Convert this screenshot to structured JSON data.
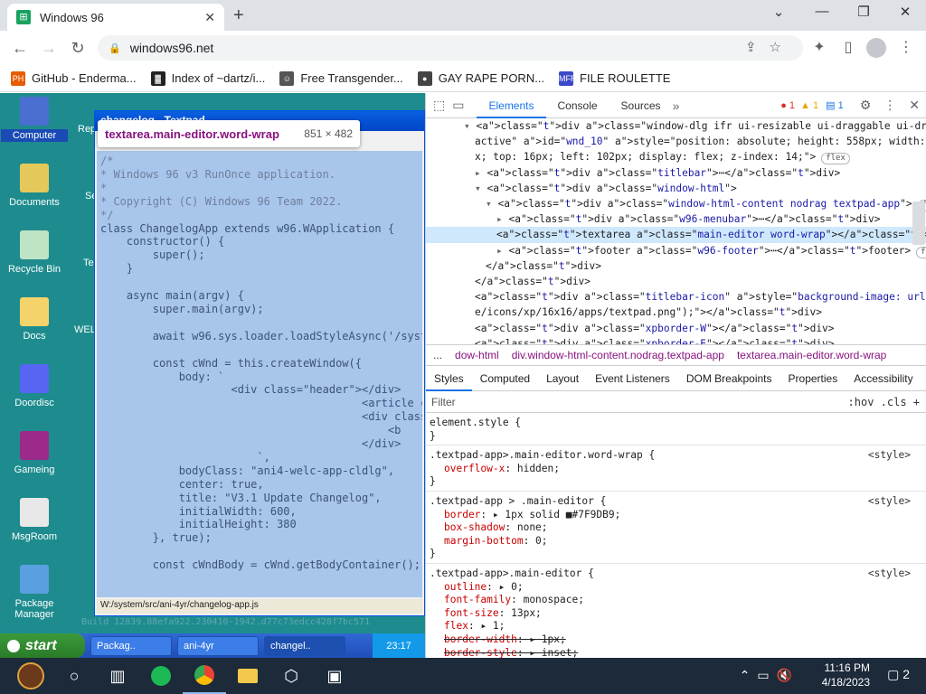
{
  "browser": {
    "tab_title": "Windows 96",
    "url": "windows96.net",
    "bookmarks": [
      {
        "label": "GitHub - Enderma...",
        "icon": "ph-icon",
        "color": "#e65c00",
        "glyph": "PH"
      },
      {
        "label": "Index of ~dartz/i...",
        "icon": "app-icon",
        "color": "#222222",
        "glyph": "▓"
      },
      {
        "label": "Free Transgender...",
        "icon": "cat-icon",
        "color": "#555555",
        "glyph": "☺"
      },
      {
        "label": "GAY RAPE PORN...",
        "icon": "globe-icon",
        "color": "#444444",
        "glyph": "●"
      },
      {
        "label": "FILE ROULETTE",
        "icon": "mfr-icon",
        "color": "#3b48c8",
        "glyph": "MFR"
      }
    ]
  },
  "desktop": {
    "icons": [
      {
        "label": "Computer",
        "color": "#4a6fd0",
        "name": "computer-icon"
      },
      {
        "label": "Documents",
        "color": "#e5c85a",
        "name": "documents-icon"
      },
      {
        "label": "Recycle Bin",
        "color": "#bfe3c5",
        "name": "recycle-bin-icon"
      },
      {
        "label": "Docs",
        "color": "#f5d36b",
        "name": "docs-folder-icon"
      },
      {
        "label": "Doordisc",
        "color": "#5865f2",
        "name": "doordisc-icon"
      },
      {
        "label": "Gameing",
        "color": "#9b2a8a",
        "name": "gameing-icon"
      },
      {
        "label": "MsgRoom",
        "color": "#e8e8e8",
        "name": "msgroom-icon"
      },
      {
        "label": "Package Manager",
        "color": "#5a9fe0",
        "name": "package-manager-icon"
      }
    ],
    "partial_labels": [
      "Rep",
      "Se",
      "Te",
      "WEL"
    ],
    "window": {
      "title": "changelog - Textpad",
      "menu": "Edit    Help",
      "footer_path": "W:/system/src/ani-4yr/changelog-app.js",
      "code_comment": "/*\n* Windows 96 v3 RunOnce application.\n*\n* Copyright (C) Windows 96 Team 2022.\n*/",
      "code_body": "\nclass ChangelogApp extends w96.WApplication {\n    constructor() {\n        super();\n    }\n\n    async main(argv) {\n        super.main(argv);\n\n        await w96.sys.loader.loadStyleAsync('/syste\n\n        const cWnd = this.createWindow({\n            body: `\n                    <div class=\"header\"></div>\n                                        <article c\n                                        <div class\n                                            <b\n                                        </div>\n                        `,\n            bodyClass: \"ani4-welc-app-cldlg\",\n            center: true,\n            title: \"V3.1 Update Changelog\",\n            initialWidth: 600,\n            initialHeight: 380\n        }, true);\n\n        const cWndBody = cWnd.getBodyContainer();"
    },
    "tooltip": {
      "tag": "textarea.main-editor.word-wrap",
      "size": "851 × 482"
    },
    "build_text": "Build 12839.88efa922.230410-1942.d77c73edcc428f7bc571",
    "taskbar": {
      "start": "start",
      "tasks": [
        "Packag..",
        "ani-4yr",
        "changel.."
      ],
      "clock": "23:17"
    }
  },
  "devtools": {
    "tabs": [
      "Elements",
      "Console",
      "Sources"
    ],
    "active_tab": "Elements",
    "error_count": "1",
    "warning_count": "1",
    "info_count": "1",
    "dom_lines": [
      {
        "indent": 3,
        "tri": "▾",
        "html": "<div class=\"window-dlg ifr ui-resizable ui-draggable ui-draggable-handle"
      },
      {
        "indent": 4,
        "tri": "",
        "html": "active\" id=\"wnd_10\" style=\"position: absolute; height: 558px; width: 859p"
      },
      {
        "indent": 4,
        "tri": "",
        "html": "x; top: 16px; left: 102px; display: flex; z-index: 14;\">",
        "badge": "flex"
      },
      {
        "indent": 4,
        "tri": "▸",
        "html": "<div class=\"titlebar\">⋯</div>"
      },
      {
        "indent": 4,
        "tri": "▾",
        "html": "<div class=\"window-html\">"
      },
      {
        "indent": 5,
        "tri": "▾",
        "html": "<div class=\"window-html-content nodrag textpad-app\">",
        "badge": "flex"
      },
      {
        "indent": 6,
        "tri": "▸",
        "html": "<div class=\"w96-menubar\">⋯</div>"
      },
      {
        "indent": 6,
        "tri": "",
        "html": "<textarea class=\"main-editor word-wrap\"></textarea> == $0",
        "selected": true
      },
      {
        "indent": 6,
        "tri": "▸",
        "html": "<footer class=\"w96-footer\">⋯</footer>",
        "badge": "flex"
      },
      {
        "indent": 5,
        "tri": "",
        "html": "</div>"
      },
      {
        "indent": 4,
        "tri": "",
        "html": "</div>"
      },
      {
        "indent": 4,
        "tri": "",
        "html": "<div class=\"titlebar-icon\" style=\"background-image: url(\"system/resourc"
      },
      {
        "indent": 4,
        "tri": "",
        "html": "e/icons/xp/16x16/apps/textpad.png\");\"></div>"
      },
      {
        "indent": 4,
        "tri": "",
        "html": "<div class=\"xpborder-W\"></div>"
      },
      {
        "indent": 4,
        "tri": "",
        "html": "<div class=\"xpborder-E\"></div>"
      }
    ],
    "breadcrumbs": [
      "...",
      "dow-html",
      "div.window-html-content.nodrag.textpad-app",
      "textarea.main-editor.word-wrap"
    ],
    "subtabs": [
      "Styles",
      "Computed",
      "Layout",
      "Event Listeners",
      "DOM Breakpoints",
      "Properties",
      "Accessibility"
    ],
    "filter_placeholder": "Filter",
    "filter_tools": ":hov  .cls  +",
    "rules": [
      {
        "selector": "element.style {",
        "source": "",
        "props": []
      },
      {
        "selector": ".textpad-app>.main-editor.word-wrap {",
        "source": "<style>",
        "props": [
          {
            "name": "overflow-x",
            "value": "hidden;",
            "strike": false
          }
        ]
      },
      {
        "selector": ".textpad-app > .main-editor {",
        "source": "<style>",
        "props": [
          {
            "name": "border",
            "value": "▸ 1px solid ■#7F9DB9;",
            "strike": false
          },
          {
            "name": "box-shadow",
            "value": "none;",
            "strike": false
          },
          {
            "name": "margin-bottom",
            "value": "0;",
            "strike": false
          }
        ]
      },
      {
        "selector": ".textpad-app>.main-editor {",
        "source": "<style>",
        "props": [
          {
            "name": "outline",
            "value": "▸ 0;",
            "strike": false
          },
          {
            "name": "font-family",
            "value": "monospace;",
            "strike": false
          },
          {
            "name": "font-size",
            "value": "13px;",
            "strike": false
          },
          {
            "name": "flex",
            "value": "▸ 1;",
            "strike": false
          },
          {
            "name": "border-width",
            "value": "▸ 1px;",
            "strike": true
          },
          {
            "name": "border-style",
            "value": "▸ inset;",
            "strike": true
          }
        ]
      }
    ]
  },
  "windows_taskbar": {
    "time": "11:16 PM",
    "date": "4/18/2023",
    "notifications": "2"
  }
}
